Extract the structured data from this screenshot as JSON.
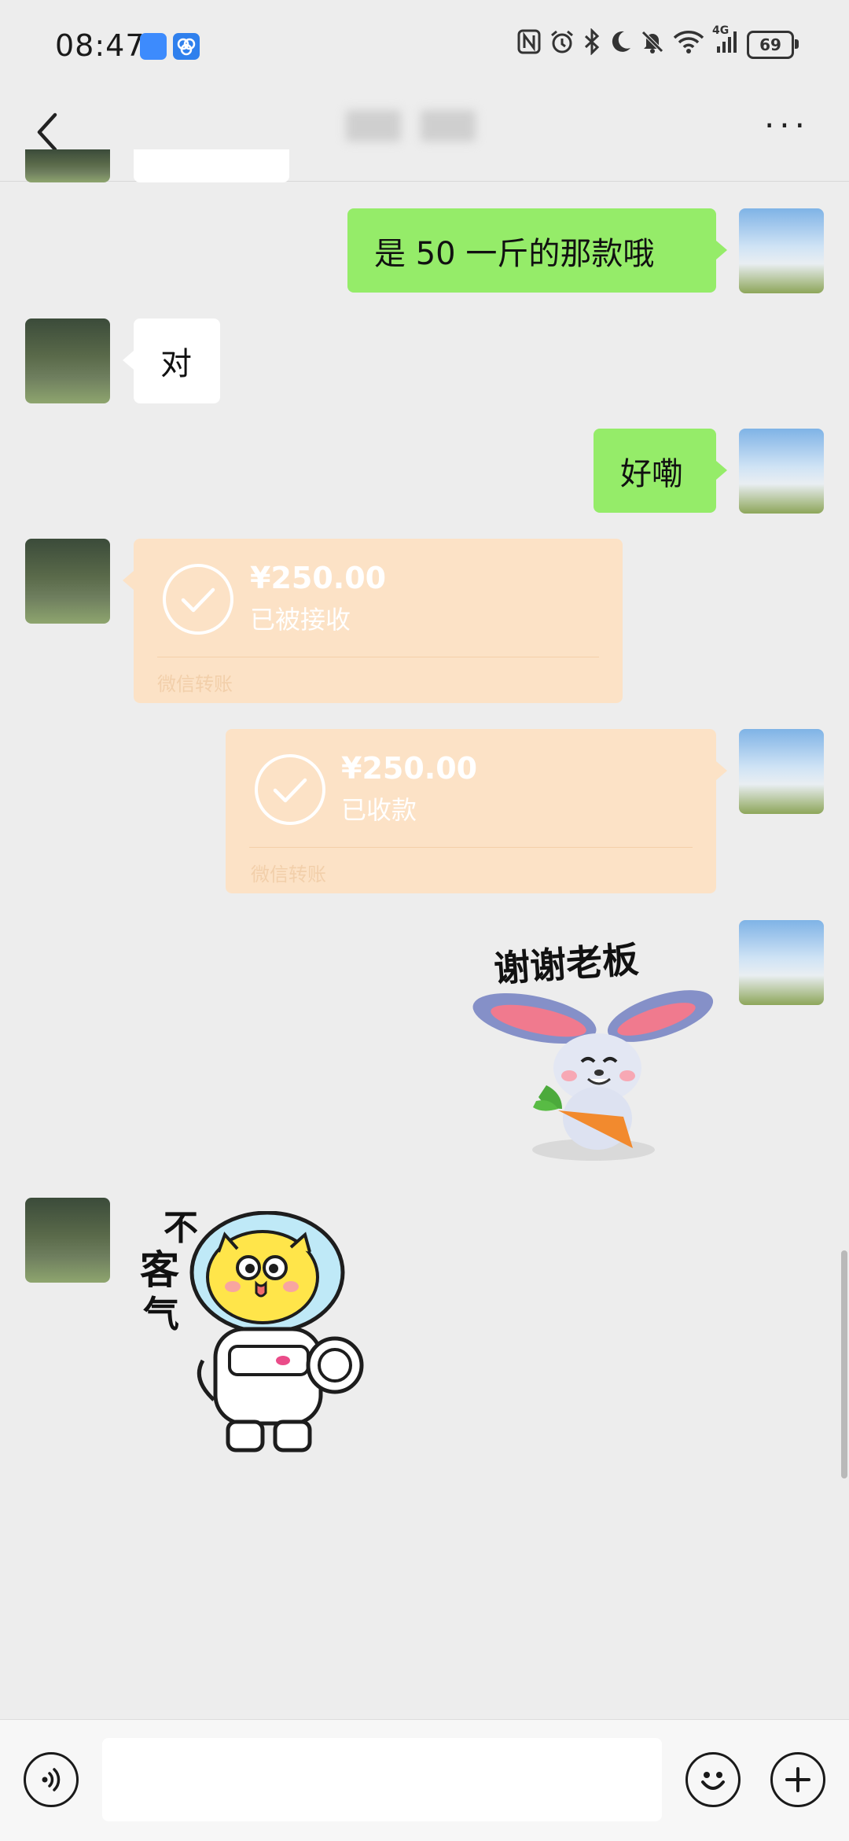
{
  "status_bar": {
    "time": "08:47",
    "battery": "69",
    "icons": [
      "nfc-icon",
      "alarm-icon",
      "bluetooth-icon",
      "moon-icon",
      "mute-icon",
      "wifi-icon",
      "signal-4g-icon",
      "battery-icon"
    ],
    "network": "4G"
  },
  "header": {
    "title": "",
    "back_icon": "chevron-left-icon",
    "more_icon": "more-icon",
    "more_label": "···"
  },
  "messages": [
    {
      "from": "self",
      "type": "text",
      "text": "是 50 一斤的那款哦"
    },
    {
      "from": "peer",
      "type": "text",
      "text": "对"
    },
    {
      "from": "self",
      "type": "text",
      "text": "好嘞"
    },
    {
      "from": "peer",
      "type": "transfer",
      "amount": "¥250.00",
      "status": "已被接收",
      "footer": "微信转账"
    },
    {
      "from": "self",
      "type": "transfer",
      "amount": "¥250.00",
      "status": "已收款",
      "footer": "微信转账"
    },
    {
      "from": "self",
      "type": "sticker",
      "caption": "谢谢老板",
      "icon": "rabbit-carrot-sticker"
    },
    {
      "from": "peer",
      "type": "sticker",
      "caption_lines": [
        "不",
        "客",
        "气"
      ],
      "icon": "astronaut-cat-sticker"
    }
  ],
  "composer": {
    "voice_icon": "voice-icon",
    "input_value": "",
    "emoji_icon": "emoji-icon",
    "plus_icon": "plus-icon"
  },
  "colors": {
    "background": "#ededed",
    "self_bubble": "#95ec69",
    "peer_bubble": "#ffffff",
    "transfer_card": "#fce2c6"
  }
}
